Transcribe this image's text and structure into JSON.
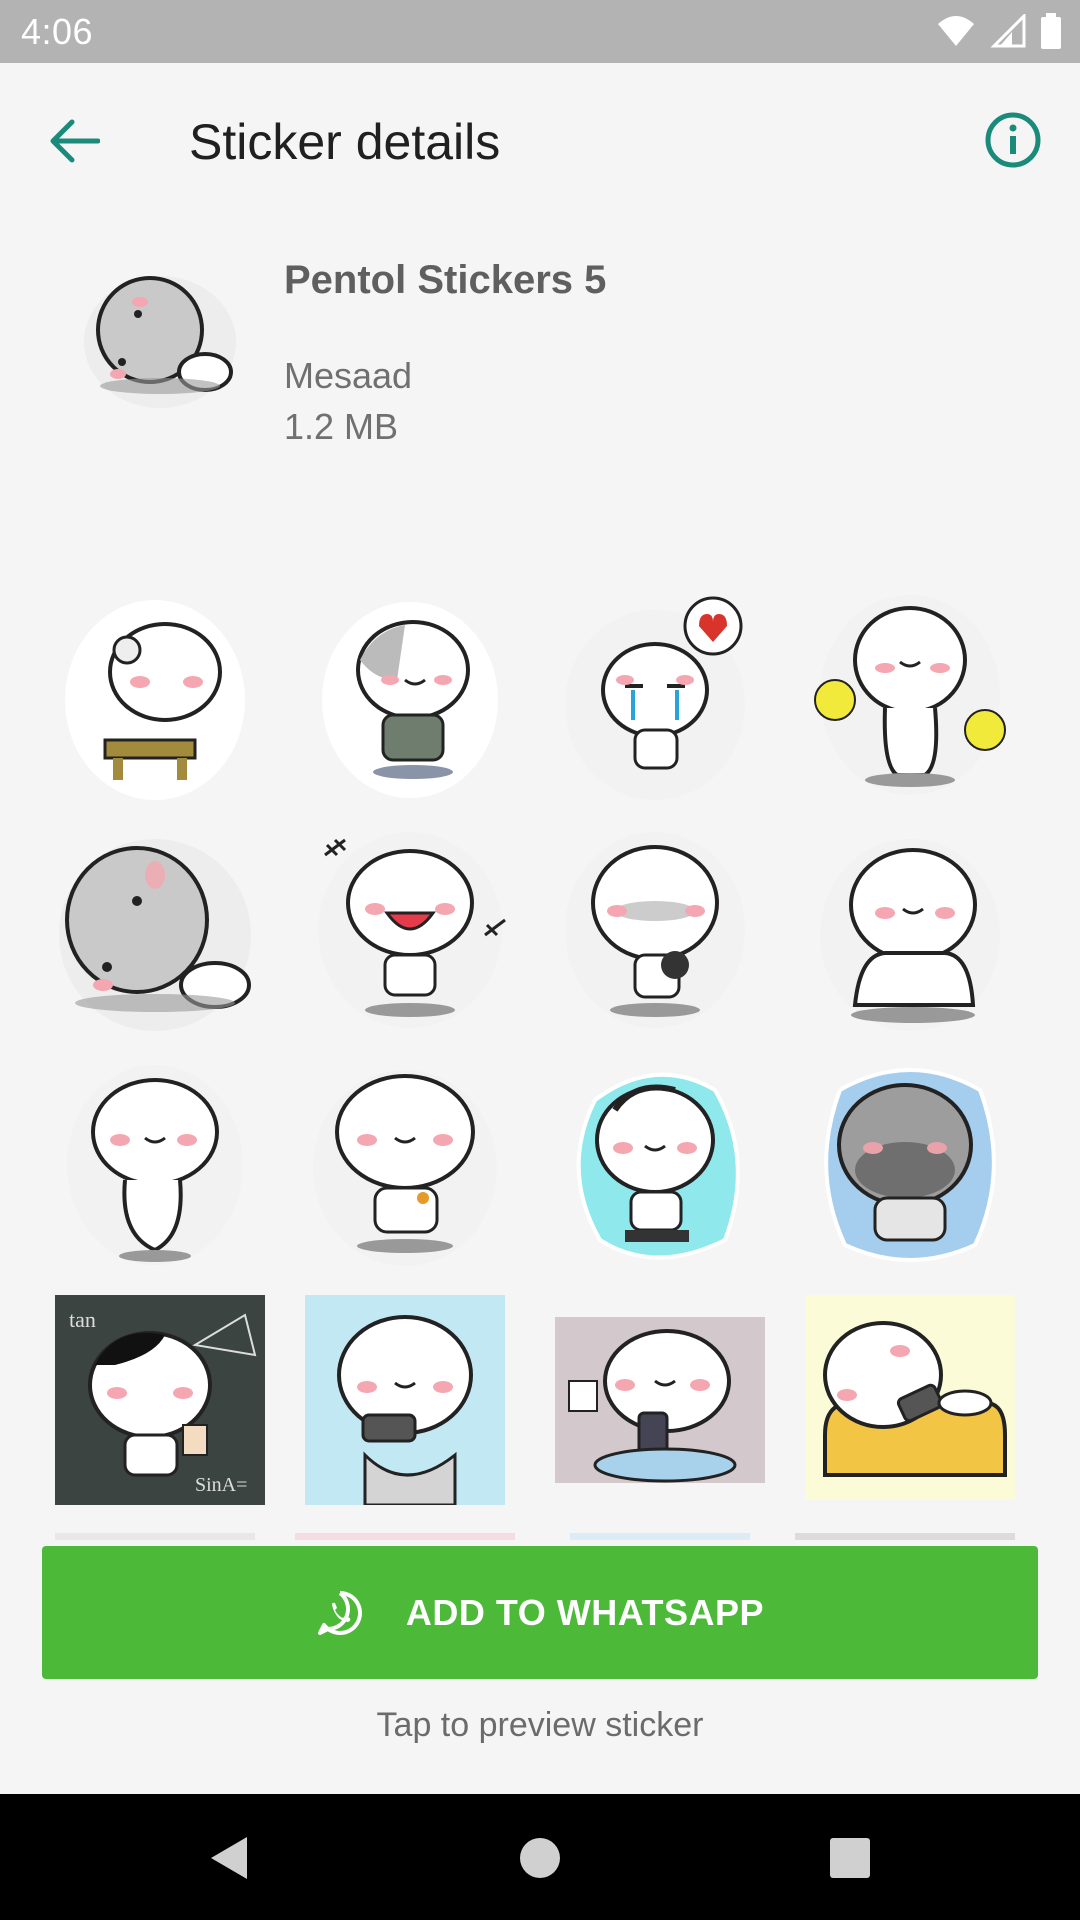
{
  "status_bar": {
    "time": "4:06",
    "icons": [
      "wifi-icon",
      "signal-icon",
      "battery-icon"
    ]
  },
  "app_bar": {
    "title": "Sticker details",
    "back_icon": "arrow-back-icon",
    "info_icon": "info-icon",
    "accent_color": "#1a8a7a"
  },
  "pack": {
    "name": "Pentol Stickers 5",
    "publisher": "Mesaad",
    "size": "1.2 MB"
  },
  "stickers": {
    "visible_rows": 4,
    "columns": 4,
    "count_shown": 16
  },
  "add_button": {
    "label": "ADD TO WHATSAPP",
    "icon": "whatsapp-icon",
    "color": "#4cb938"
  },
  "hint": "Tap to preview sticker",
  "nav_bar": {
    "items": [
      "back-triangle-icon",
      "home-circle-icon",
      "recents-square-icon"
    ]
  }
}
